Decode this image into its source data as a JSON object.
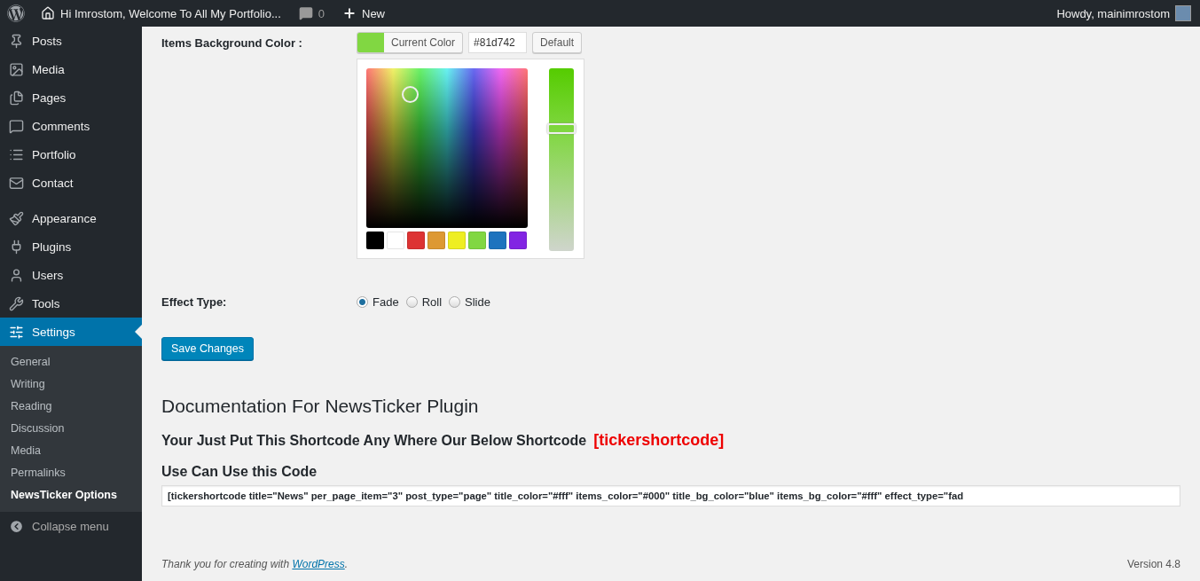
{
  "admin_bar": {
    "site_title": "Hi Imrostom, Welcome To All My Portfolio...",
    "comments_count": "0",
    "new_label": "New",
    "greeting": "Howdy, mainimrostom"
  },
  "sidebar": {
    "groups": [
      [
        {
          "label": "Posts",
          "selected": false
        },
        {
          "label": "Media",
          "selected": false
        },
        {
          "label": "Pages",
          "selected": false
        },
        {
          "label": "Comments",
          "selected": false
        },
        {
          "label": "Portfolio",
          "selected": false
        },
        {
          "label": "Contact",
          "selected": false
        }
      ],
      [
        {
          "label": "Appearance",
          "selected": false
        },
        {
          "label": "Plugins",
          "selected": false
        },
        {
          "label": "Users",
          "selected": false
        },
        {
          "label": "Tools",
          "selected": false
        },
        {
          "label": "Settings",
          "selected": true
        }
      ]
    ],
    "submenu": [
      {
        "label": "General",
        "selected": false
      },
      {
        "label": "Writing",
        "selected": false
      },
      {
        "label": "Reading",
        "selected": false
      },
      {
        "label": "Discussion",
        "selected": false
      },
      {
        "label": "Media",
        "selected": false
      },
      {
        "label": "Permalinks",
        "selected": false
      },
      {
        "label": "NewsTicker Options",
        "selected": true
      }
    ],
    "collapse_label": "Collapse menu"
  },
  "form": {
    "rows": [
      {
        "kind": "color",
        "label": "Items Background Color :",
        "button": "Current Color",
        "value": "#81d742",
        "default_button": "Default",
        "level": 0.68,
        "palette": [
          {
            "color": "#000000"
          },
          {
            "color": "#ffffff"
          },
          {
            "color": "#dd3333"
          },
          {
            "color": "#dd9933"
          },
          {
            "color": "#eeee22"
          },
          {
            "color": "#81d742"
          },
          {
            "color": "#1e73be"
          },
          {
            "color": "#8224e3"
          }
        ]
      },
      {
        "kind": "radio",
        "label": "Effect Type:",
        "options": [
          {
            "label": "Fade",
            "selected": true
          },
          {
            "label": "Roll",
            "selected": false
          },
          {
            "label": "Slide",
            "selected": false
          }
        ]
      }
    ],
    "save_button": "Save Changes"
  },
  "documentation": {
    "title": "Documentation For NewsTicker Plugin",
    "instruction": "Your Just Put This Shortcode Any Where Our Below Shortcode",
    "shortcode": "[tickershortcode]",
    "code_heading": "Use Can Use this Code",
    "code_value": "[tickershortcode title=\"News\" per_page_item=\"3\" post_type=\"page\" title_color=\"#fff\" items_color=\"#000\" title_bg_color=\"blue\" items_bg_color=\"#fff\" effect_type=\"fad"
  },
  "footer": {
    "thanks": "Thank you for creating with ",
    "link": "WordPress",
    "end": ".",
    "version": "Version 4.8"
  }
}
